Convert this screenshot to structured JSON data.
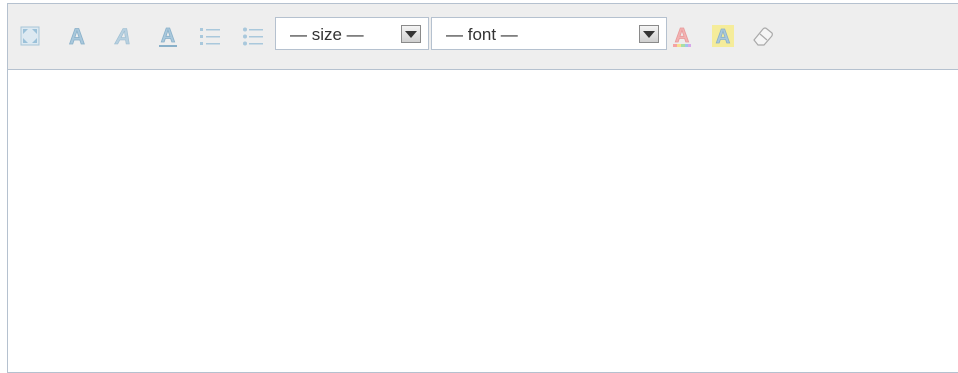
{
  "toolbar": {
    "buttons": [
      {
        "id": "fullscreen",
        "icon": "fullscreen-icon"
      },
      {
        "id": "bold",
        "icon": "bold-icon"
      },
      {
        "id": "italic",
        "icon": "italic-icon"
      },
      {
        "id": "underline",
        "icon": "underline-icon"
      },
      {
        "id": "ordered-list",
        "icon": "ordered-list-icon"
      },
      {
        "id": "unordered-list",
        "icon": "unordered-list-icon"
      },
      {
        "id": "font-color",
        "icon": "font-color-icon"
      },
      {
        "id": "highlight",
        "icon": "highlight-icon"
      },
      {
        "id": "remove-format",
        "icon": "eraser-icon"
      }
    ],
    "size_select": {
      "selected": "— size —"
    },
    "font_select": {
      "selected": "— font —"
    }
  },
  "colors": {
    "toolbar_bg": "#eeeeee",
    "border": "#b5c1cf",
    "icon_blue": "#9bc1d9",
    "font_color_icon": "#f0a0a0",
    "highlight_bg": "#f5ec9a"
  },
  "content": {
    "text": ""
  }
}
